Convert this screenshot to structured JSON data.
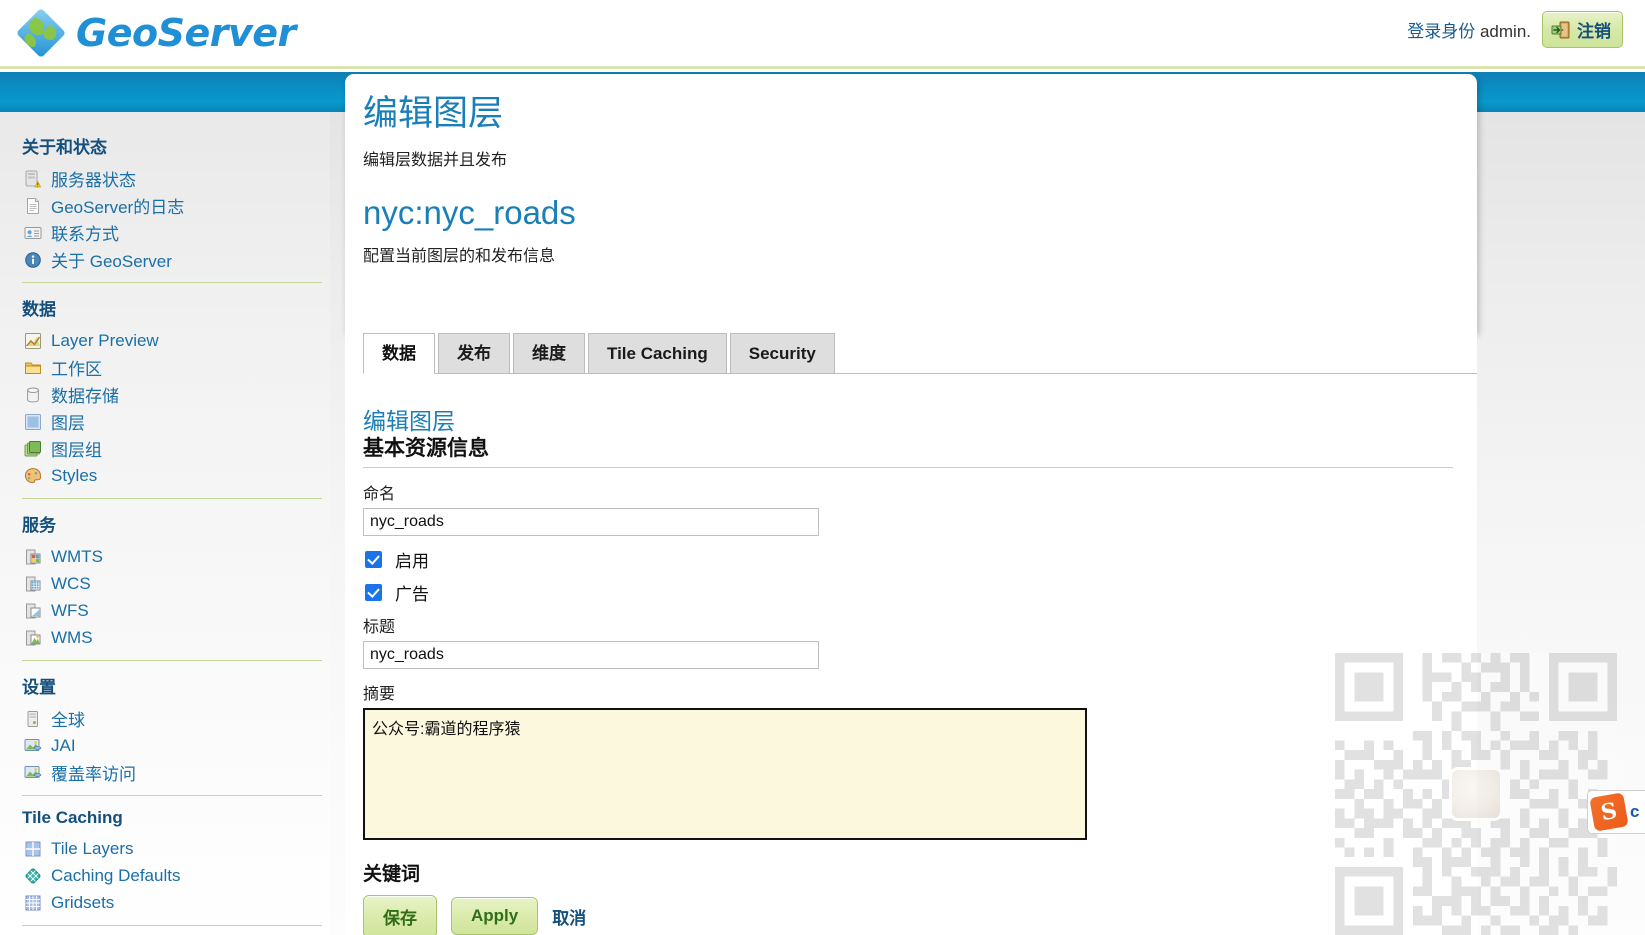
{
  "header": {
    "logo_text": "GeoServer",
    "logo_icon": "globe-icon",
    "login_status_prefix": "登录身份",
    "login_user": "admin.",
    "logout_label": "注销",
    "logout_icon": "logout-door-icon"
  },
  "sidebar": {
    "groups": [
      {
        "title": "关于和状态",
        "items": [
          {
            "label": "服务器状态",
            "icon": "server-status-icon"
          },
          {
            "label": "GeoServer的日志",
            "icon": "document-log-icon"
          },
          {
            "label": "联系方式",
            "icon": "contact-card-icon"
          },
          {
            "label": "关于 GeoServer",
            "icon": "info-circle-icon"
          }
        ]
      },
      {
        "title": "数据",
        "items": [
          {
            "label": "Layer Preview",
            "icon": "layer-preview-icon"
          },
          {
            "label": "工作区",
            "icon": "folder-icon"
          },
          {
            "label": "数据存储",
            "icon": "database-icon"
          },
          {
            "label": "图层",
            "icon": "layer-icon"
          },
          {
            "label": "图层组",
            "icon": "layer-group-icon"
          },
          {
            "label": "Styles",
            "icon": "palette-icon"
          }
        ]
      },
      {
        "title": "服务",
        "items": [
          {
            "label": "WMTS",
            "icon": "wmts-icon"
          },
          {
            "label": "WCS",
            "icon": "wcs-icon"
          },
          {
            "label": "WFS",
            "icon": "wfs-icon"
          },
          {
            "label": "WMS",
            "icon": "wms-icon"
          }
        ]
      },
      {
        "title": "设置",
        "items": [
          {
            "label": "全球",
            "icon": "global-settings-icon"
          },
          {
            "label": "JAI",
            "icon": "jai-image-icon"
          },
          {
            "label": "覆盖率访问",
            "icon": "coverage-access-icon"
          }
        ]
      },
      {
        "title": "Tile Caching",
        "items": [
          {
            "label": "Tile Layers",
            "icon": "tile-grid-icon"
          },
          {
            "label": "Caching Defaults",
            "icon": "cache-globe-icon"
          },
          {
            "label": "Gridsets",
            "icon": "gridset-icon"
          }
        ]
      }
    ]
  },
  "main": {
    "page_title": "编辑图层",
    "page_subtitle": "编辑层数据并且发布",
    "resource_title": "nyc:nyc_roads",
    "resource_subtitle": "配置当前图层的和发布信息",
    "tabs": [
      {
        "label": "数据",
        "active": true
      },
      {
        "label": "发布",
        "active": false
      },
      {
        "label": "维度",
        "active": false
      },
      {
        "label": "Tile Caching",
        "active": false
      },
      {
        "label": "Security",
        "active": false
      }
    ]
  },
  "form": {
    "heading_link": "编辑图层",
    "heading": "基本资源信息",
    "name_label": "命名",
    "name_value": "nyc_roads",
    "enabled_label": "启用",
    "enabled_checked": true,
    "advertised_label": "广告",
    "advertised_checked": true,
    "title_label": "标题",
    "title_value": "nyc_roads",
    "abstract_label": "摘要",
    "abstract_value": "公众号:霸道的程序猿",
    "keywords_label": "关键词",
    "save_label": "保存",
    "apply_label": "Apply",
    "cancel_label": "取消"
  },
  "overlays": {
    "watermark_name": "qr-code-watermark",
    "ime_name": "sogou-input-method",
    "ime_letter": "c"
  },
  "colors": {
    "brand_blue": "#0a8ec4",
    "link_blue": "#1a6fa8",
    "heading_blue": "#15507d",
    "accent_green": "#cfe49a",
    "rule_green": "#c6d79a",
    "focus_yellow": "#fcf8dd",
    "checkbox_blue": "#1a73e8"
  }
}
